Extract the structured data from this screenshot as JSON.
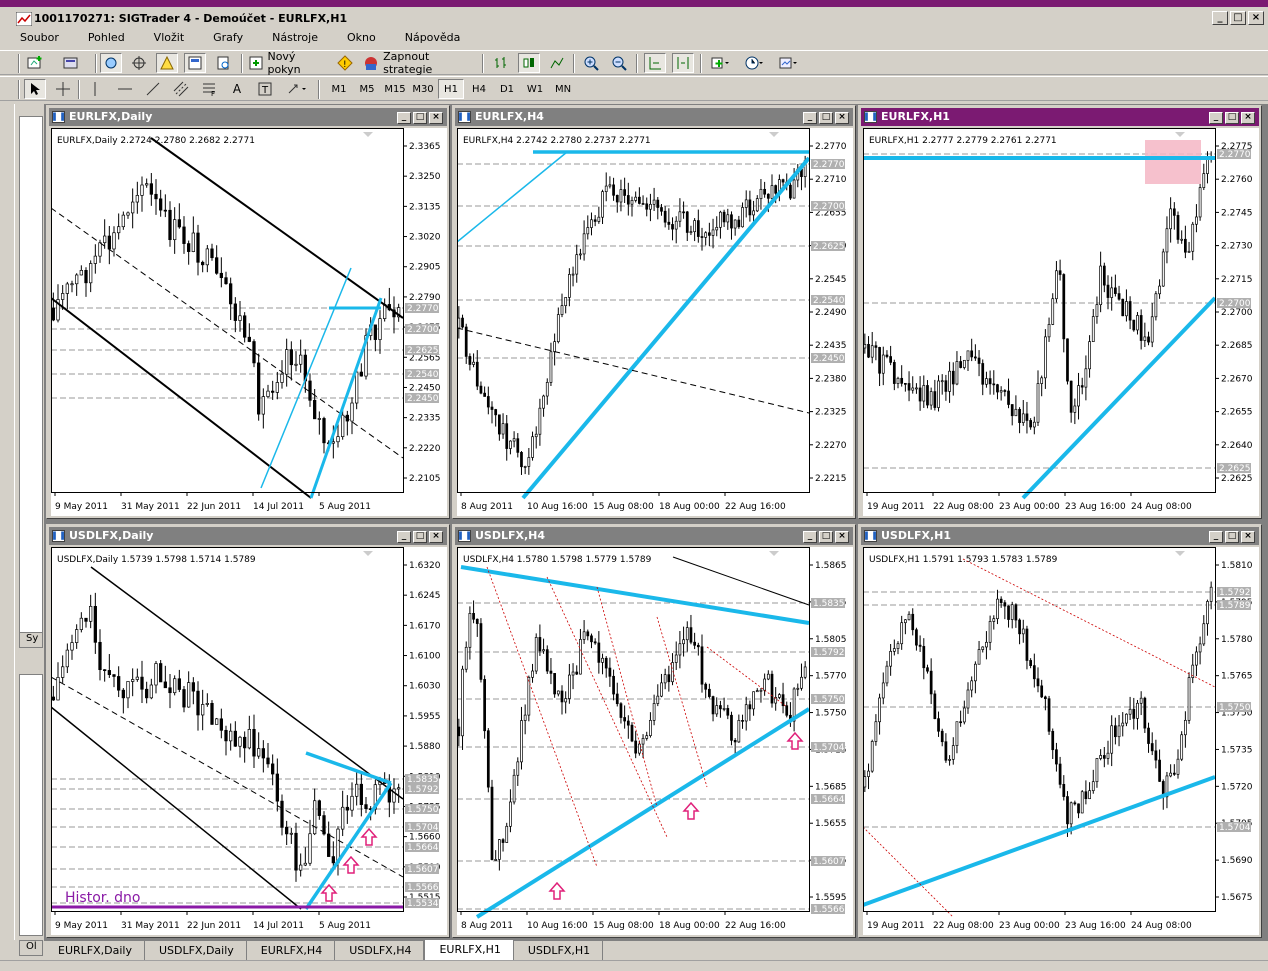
{
  "app": {
    "title": "1001170271: SIGTrader 4 - Demoúčet - EURLFX,H1"
  },
  "menu": [
    "Soubor",
    "Pohled",
    "Vložit",
    "Grafy",
    "Nástroje",
    "Okno",
    "Nápověda"
  ],
  "toolbar": {
    "new_order": "Nový pokyn",
    "strategy": "Zapnout strategie"
  },
  "timeframes": [
    "M1",
    "M5",
    "M15",
    "M30",
    "H1",
    "H4",
    "D1",
    "W1",
    "MN"
  ],
  "active_timeframe": "H1",
  "side": {
    "tab1": "Sy",
    "tab2": "Ol"
  },
  "tabs": [
    "EURLFX,Daily",
    "USDLFX,Daily",
    "EURLFX,H4",
    "USDLFX,H4",
    "EURLFX,H1",
    "USDLFX,H1"
  ],
  "active_tab": 4,
  "colors": {
    "accent": "#7b1a72",
    "trend": "#1ab8ea",
    "candle_up": "#ffffff",
    "candle_down": "#000000",
    "annot": "#e0207a",
    "hist_line": "#8a1aa6"
  },
  "charts": [
    {
      "window_title": "EURLFX,Daily",
      "header": "EURLFX,Daily  2.2724 2.2780 2.2682 2.2771",
      "price_ticks": [
        "2.3365",
        "2.3250",
        "2.3135",
        "2.3020",
        "2.2905",
        "2.2790",
        "2.2675",
        "2.2565",
        "2.2450",
        "2.2335",
        "2.2220",
        "2.2105"
      ],
      "level_labels": [
        "2.2770",
        "2.2700",
        "2.2625",
        "2.2540",
        "2.2450"
      ],
      "time_ticks": [
        "9 May 2011",
        "31 May 2011",
        "22 Jun 2011",
        "14 Jul 2011",
        "5 Aug 2011"
      ]
    },
    {
      "window_title": "EURLFX,H4",
      "header": "EURLFX,H4  2.2742 2.2780 2.2737 2.2771",
      "price_ticks": [
        "2.2770",
        "2.2710",
        "2.2655",
        "2.2600",
        "2.2545",
        "2.2490",
        "2.2435",
        "2.2380",
        "2.2325",
        "2.2270",
        "2.2215"
      ],
      "level_labels": [
        "2.2770",
        "2.2700",
        "2.2625",
        "2.2540",
        "2.2450"
      ],
      "time_ticks": [
        "8 Aug 2011",
        "10 Aug 16:00",
        "15 Aug 08:00",
        "18 Aug 00:00",
        "22 Aug 16:00"
      ]
    },
    {
      "window_title": "EURLFX,H1",
      "header": "EURLFX,H1  2.2777 2.2779 2.2761 2.2771",
      "price_ticks": [
        "2.2775",
        "2.2760",
        "2.2745",
        "2.2730",
        "2.2715",
        "2.2700",
        "2.2685",
        "2.2670",
        "2.2655",
        "2.2640",
        "2.2625"
      ],
      "level_labels": [
        "2.2770",
        "2.2700",
        "2.2625"
      ],
      "time_ticks": [
        "19 Aug 2011",
        "22 Aug 08:00",
        "23 Aug 00:00",
        "23 Aug 16:00",
        "24 Aug 08:00"
      ]
    },
    {
      "window_title": "USDLFX,Daily",
      "header": "USDLFX,Daily  1.5739 1.5798 1.5714 1.5789",
      "price_ticks": [
        "1.6320",
        "1.6245",
        "1.6170",
        "1.6100",
        "1.6030",
        "1.5955",
        "1.5880",
        "1.5810",
        "1.5735",
        "1.5660",
        "1.5590",
        "1.5515"
      ],
      "level_labels": [
        "1.5835",
        "1.5792",
        "1.5750",
        "1.5704",
        "1.5664",
        "1.5607",
        "1.5566",
        "1.5534"
      ],
      "time_ticks": [
        "9 May 2011",
        "31 May 2011",
        "22 Jun 2011",
        "14 Jul 2011",
        "5 Aug 2011"
      ],
      "annotation": "Histor. dno"
    },
    {
      "window_title": "USDLFX,H4",
      "header": "USDLFX,H4  1.5780 1.5798 1.5779 1.5789",
      "price_ticks": [
        "1.5865",
        "1.5835",
        "1.5805",
        "1.5770",
        "1.5750",
        "1.5715",
        "1.5685",
        "1.5655",
        "1.5625",
        "1.5595"
      ],
      "level_labels": [
        "1.5835",
        "1.5792",
        "1.5750",
        "1.5704",
        "1.5664",
        "1.5607",
        "1.5566"
      ],
      "time_ticks": [
        "8 Aug 2011",
        "10 Aug 16:00",
        "15 Aug 08:00",
        "18 Aug 00:00",
        "22 Aug 16:00"
      ]
    },
    {
      "window_title": "USDLFX,H1",
      "header": "USDLFX,H1  1.5791 1.5793 1.5783 1.5789",
      "price_ticks": [
        "1.5810",
        "1.5795",
        "1.5780",
        "1.5765",
        "1.5750",
        "1.5735",
        "1.5720",
        "1.5705",
        "1.5690",
        "1.5675"
      ],
      "level_labels": [
        "1.5792",
        "1.5789",
        "1.5750",
        "1.5704"
      ],
      "time_ticks": [
        "19 Aug 2011",
        "22 Aug 08:00",
        "23 Aug 00:00",
        "23 Aug 16:00",
        "24 Aug 08:00"
      ]
    }
  ]
}
